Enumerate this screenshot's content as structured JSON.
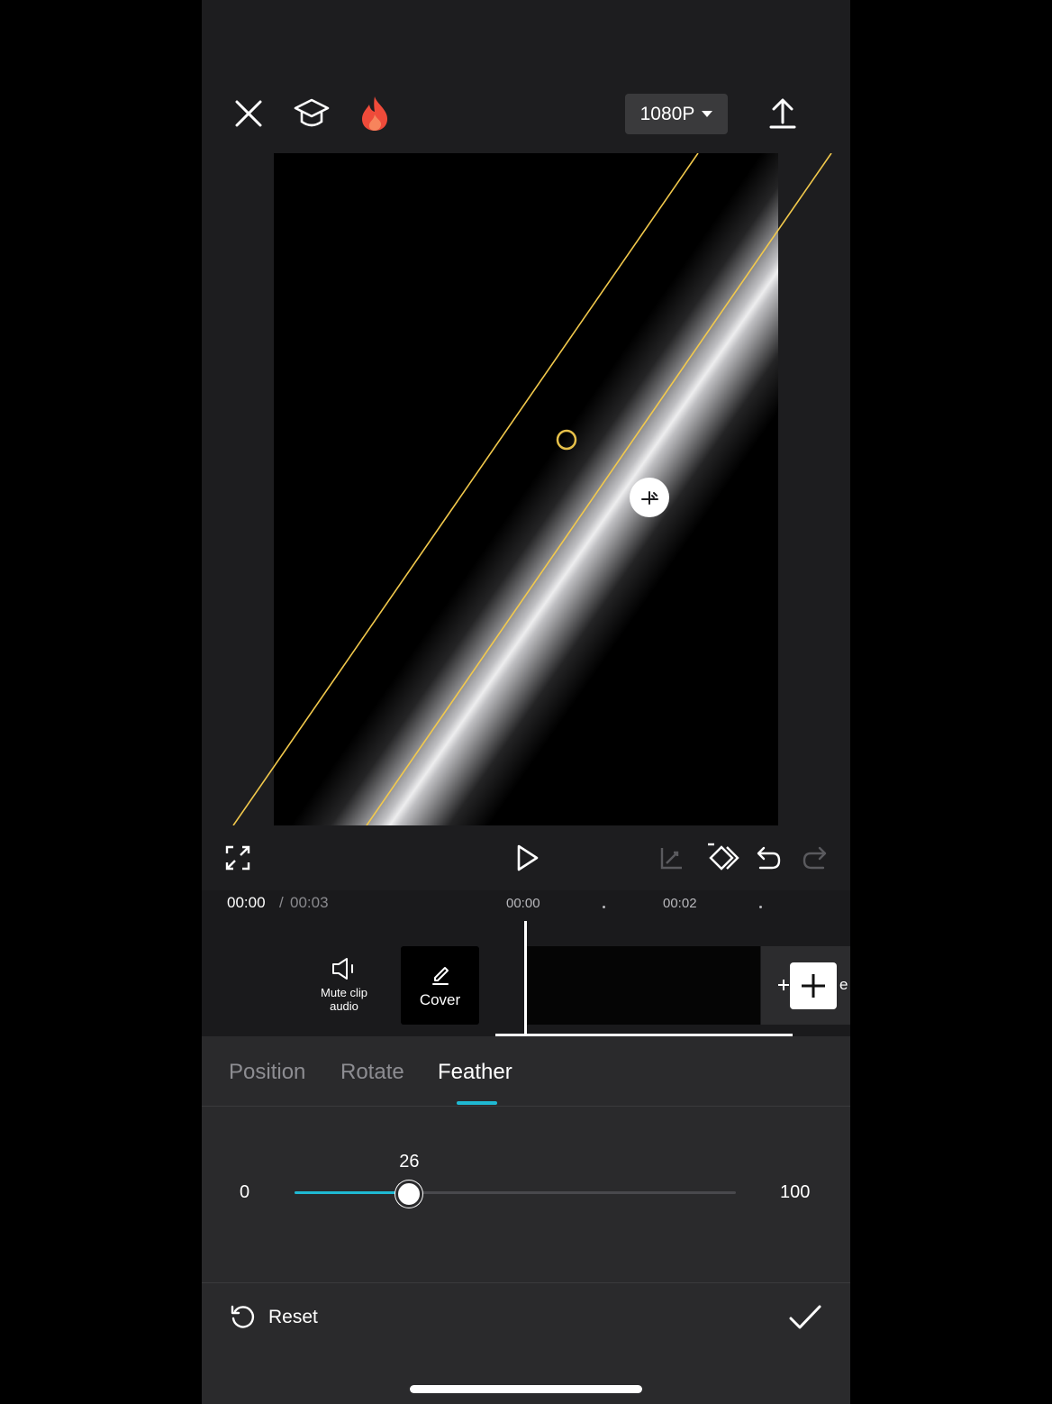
{
  "header": {
    "resolution": "1080P",
    "icons": [
      "close-icon",
      "tutorial-icon",
      "trending-icon",
      "export-icon"
    ]
  },
  "preview": {
    "overlay_color": "#f2c94c"
  },
  "playback": {
    "icons": [
      "fullscreen-icon",
      "play-icon",
      "keyframe-curve-icon",
      "keyframe-icon",
      "undo-icon",
      "redo-icon"
    ]
  },
  "timeline": {
    "current_time": "00:00",
    "separator": "/",
    "total_time": "00:03",
    "ticks": [
      "00:00",
      "00:02"
    ]
  },
  "tools": {
    "mute_label_1": "Mute clip",
    "mute_label_2": "audio",
    "cover_label": "Cover",
    "add_trailing": "e"
  },
  "tabs": {
    "items": [
      "Position",
      "Rotate",
      "Feather"
    ],
    "active": "Feather"
  },
  "feather": {
    "value": "26",
    "min": "0",
    "max": "100",
    "accent": "#1fb9d3"
  },
  "footer": {
    "reset_label": "Reset"
  }
}
